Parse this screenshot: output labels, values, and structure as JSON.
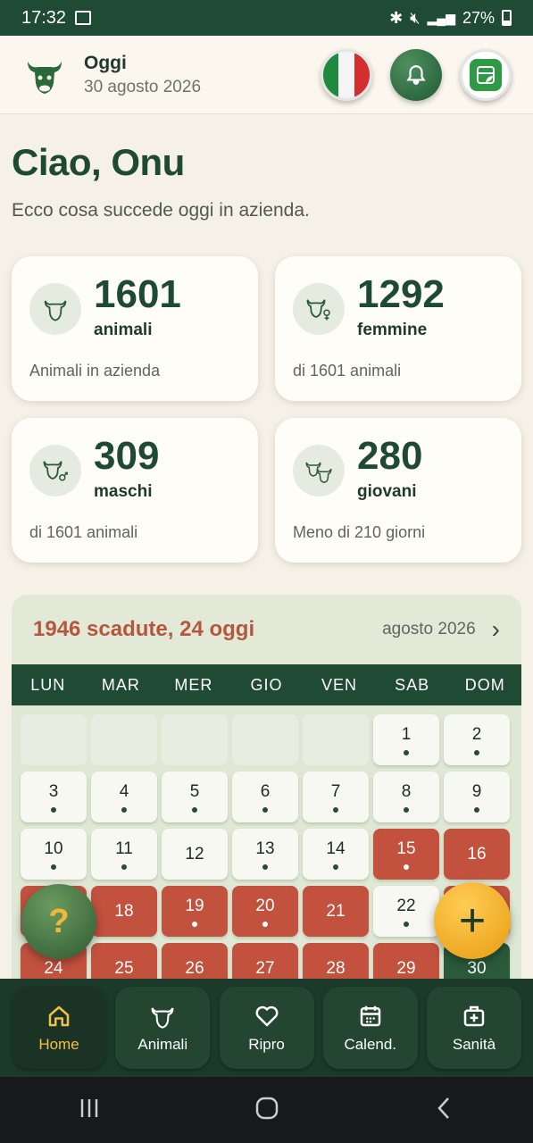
{
  "status": {
    "time": "17:32",
    "battery": "27%"
  },
  "header": {
    "title": "Oggi",
    "date": "30 agosto 2026"
  },
  "greeting": {
    "title": "Ciao, Onu",
    "subtitle": "Ecco cosa succede oggi in azienda."
  },
  "stats": [
    {
      "value": "1601",
      "label": "animali",
      "desc": "Animali in azienda",
      "icon": "cow-icon"
    },
    {
      "value": "1292",
      "label": "femmine",
      "desc": "di 1601 animali",
      "icon": "cow-female-icon"
    },
    {
      "value": "309",
      "label": "maschi",
      "desc": "di 1601 animali",
      "icon": "cow-male-icon"
    },
    {
      "value": "280",
      "label": "giovani",
      "desc": "Meno di 210 giorni",
      "icon": "calves-icon"
    }
  ],
  "calendar": {
    "summary": "1946 scadute, 24 oggi",
    "month": "agosto 2026",
    "weekdays": [
      "LUN",
      "MAR",
      "MER",
      "GIO",
      "VEN",
      "SAB",
      "DOM"
    ],
    "days": [
      {
        "n": "",
        "t": "empty"
      },
      {
        "n": "",
        "t": "empty"
      },
      {
        "n": "",
        "t": "empty"
      },
      {
        "n": "",
        "t": "empty"
      },
      {
        "n": "",
        "t": "empty"
      },
      {
        "n": "1",
        "t": "normal",
        "dot": true
      },
      {
        "n": "2",
        "t": "normal",
        "dot": true
      },
      {
        "n": "3",
        "t": "normal",
        "dot": true
      },
      {
        "n": "4",
        "t": "normal",
        "dot": true
      },
      {
        "n": "5",
        "t": "normal",
        "dot": true
      },
      {
        "n": "6",
        "t": "normal",
        "dot": true
      },
      {
        "n": "7",
        "t": "normal",
        "dot": true
      },
      {
        "n": "8",
        "t": "normal",
        "dot": true
      },
      {
        "n": "9",
        "t": "normal",
        "dot": true
      },
      {
        "n": "10",
        "t": "normal",
        "dot": true
      },
      {
        "n": "11",
        "t": "normal",
        "dot": true
      },
      {
        "n": "12",
        "t": "normal",
        "dot": false
      },
      {
        "n": "13",
        "t": "normal",
        "dot": true
      },
      {
        "n": "14",
        "t": "normal",
        "dot": true
      },
      {
        "n": "15",
        "t": "red",
        "dot": true
      },
      {
        "n": "16",
        "t": "red",
        "dot": false
      },
      {
        "n": "17",
        "t": "red",
        "dot": false
      },
      {
        "n": "18",
        "t": "red",
        "dot": false
      },
      {
        "n": "19",
        "t": "red",
        "dot": true
      },
      {
        "n": "20",
        "t": "red",
        "dot": true
      },
      {
        "n": "21",
        "t": "red",
        "dot": false
      },
      {
        "n": "22",
        "t": "normal",
        "dot": true
      },
      {
        "n": "23",
        "t": "red",
        "dot": false
      },
      {
        "n": "24",
        "t": "red",
        "dot": false
      },
      {
        "n": "25",
        "t": "red",
        "dot": false
      },
      {
        "n": "26",
        "t": "red",
        "dot": false
      },
      {
        "n": "27",
        "t": "red",
        "dot": false
      },
      {
        "n": "28",
        "t": "red",
        "dot": false
      },
      {
        "n": "29",
        "t": "red",
        "dot": false
      },
      {
        "n": "30",
        "t": "green",
        "dot": false
      }
    ]
  },
  "fab": {
    "help": "?",
    "add": "+"
  },
  "nav": [
    {
      "label": "Home",
      "icon": "home-icon",
      "active": true
    },
    {
      "label": "Animali",
      "icon": "cow-icon",
      "active": false
    },
    {
      "label": "Ripro",
      "icon": "heart-icon",
      "active": false
    },
    {
      "label": "Calend.",
      "icon": "calendar-icon",
      "active": false
    },
    {
      "label": "Sanità",
      "icon": "medical-kit-icon",
      "active": false
    }
  ],
  "colors": {
    "primary": "#1f4a33",
    "accent": "#f2c046",
    "overdue": "#c2513e",
    "background": "#f6f1e7"
  }
}
